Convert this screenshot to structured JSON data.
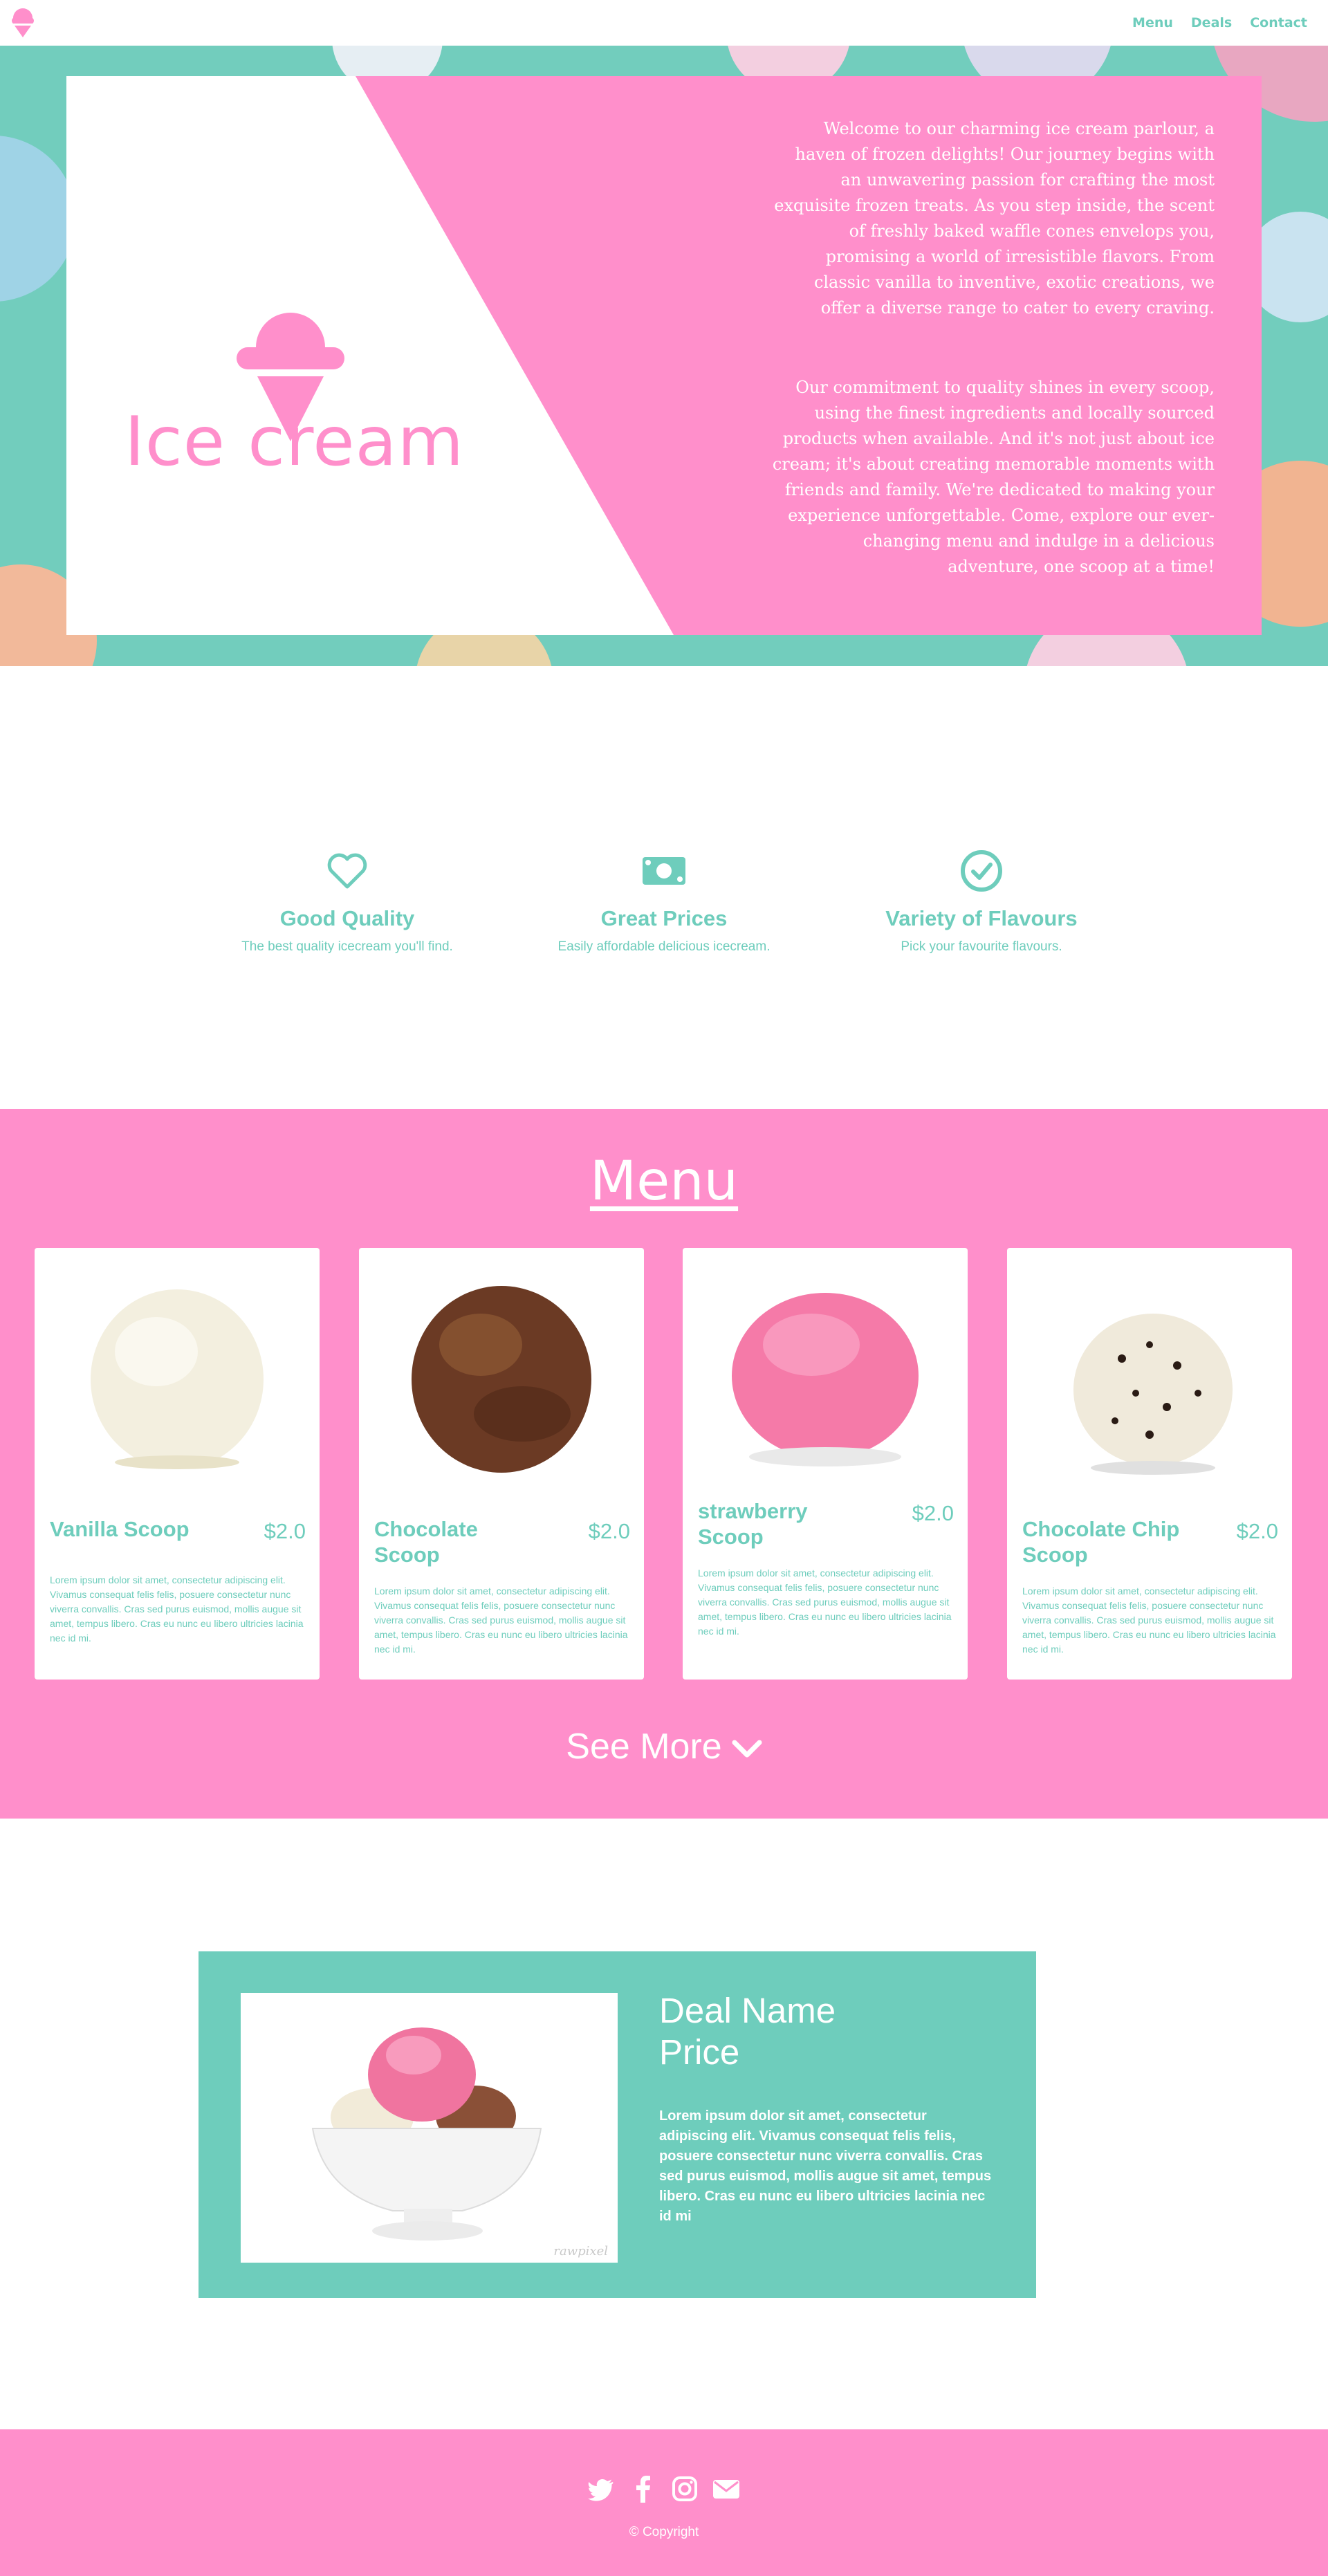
{
  "colors": {
    "accent_teal": "#6ecdbc",
    "accent_pink": "#ff8fcb",
    "white": "#ffffff"
  },
  "nav": {
    "logo_icon": "ice-cream-cone-icon",
    "links": [
      "Menu",
      "Deals",
      "Contact"
    ]
  },
  "hero": {
    "title": "Ice cream",
    "paragraph_1": "Welcome to our charming ice cream parlour, a haven of frozen delights! Our journey begins with an unwavering passion for crafting the most exquisite frozen treats. As you step inside, the scent of freshly baked waffle cones envelops you, promising a world of irresistible flavors. From classic vanilla to inventive, exotic creations, we offer a diverse range to cater to every craving.",
    "paragraph_2": "Our commitment to quality shines in every scoop, using the finest ingredients and locally sourced products when available. And it's not just about ice cream; it's about creating memorable moments with friends and family. We're dedicated to making your experience unforgettable. Come, explore our ever-changing menu and indulge in a delicious adventure, one scoop at a time!"
  },
  "features": [
    {
      "icon": "heart-icon",
      "title": "Good Quality",
      "text": "The best quality icecream you'll find."
    },
    {
      "icon": "money-bill-icon",
      "title": "Great Prices",
      "text": "Easily affordable delicious icecream."
    },
    {
      "icon": "check-circle-icon",
      "title": "Variety of Flavours",
      "text": "Pick your favourite flavours."
    }
  ],
  "menu": {
    "heading": "Menu",
    "items": [
      {
        "name": "Vanilla Scoop",
        "price": "$2.0",
        "description": "Lorem ipsum dolor sit amet, consectetur adipiscing elit. Vivamus consequat felis felis, posuere consectetur nunc viverra convallis. Cras sed purus euismod, mollis augue sit amet, tempus libero. Cras eu nunc eu libero ultricies lacinia nec id mi.",
        "color": "#f3efdf"
      },
      {
        "name": "Chocolate Scoop",
        "price": "$2.0",
        "description": "Lorem ipsum dolor sit amet, consectetur adipiscing elit. Vivamus consequat felis felis, posuere consectetur nunc viverra convallis. Cras sed purus euismod, mollis augue sit amet, tempus libero. Cras eu nunc eu libero ultricies lacinia nec id mi.",
        "color": "#6b3a24"
      },
      {
        "name": "strawberry Scoop",
        "price": "$2.0",
        "description": "Lorem ipsum dolor sit amet, consectetur adipiscing elit. Vivamus consequat felis felis, posuere consectetur nunc viverra convallis. Cras sed purus euismod, mollis augue sit amet, tempus libero. Cras eu nunc eu libero ultricies lacinia nec id mi.",
        "color": "#f57aa8"
      },
      {
        "name": "Chocolate Chip Scoop",
        "price": "$2.0",
        "description": "Lorem ipsum dolor sit amet, consectetur adipiscing elit. Vivamus consequat felis felis, posuere consectetur nunc viverra convallis. Cras sed purus euismod, mollis augue sit amet, tempus libero. Cras eu nunc eu libero ultricies lacinia nec id mi.",
        "color": "#f0eadb"
      }
    ],
    "see_more": "See More"
  },
  "deal": {
    "title_line_1": "Deal Name",
    "title_line_2": "Price",
    "description": "Lorem ipsum dolor sit amet, consectetur adipiscing elit. Vivamus consequat felis felis, posuere consectetur nunc viverra convallis. Cras sed purus euismod, mollis augue sit amet, tempus libero. Cras eu nunc eu libero ultricies lacinia nec id mi",
    "image_watermark": "rawpixel"
  },
  "footer": {
    "social": [
      "twitter-icon",
      "facebook-icon",
      "instagram-icon",
      "email-icon"
    ],
    "copyright": "© Copyright"
  }
}
